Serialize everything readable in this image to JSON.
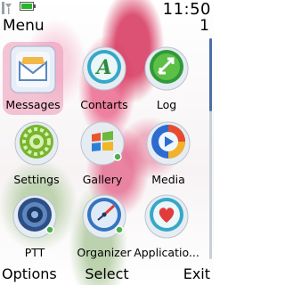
{
  "status": {
    "time": "11:50"
  },
  "header": {
    "title": "Menu",
    "page": "1"
  },
  "menu": {
    "items": [
      {
        "label": "Messages",
        "icon": "messages-icon",
        "selected": true
      },
      {
        "label": "Contarts",
        "icon": "contacts-icon"
      },
      {
        "label": "Log",
        "icon": "log-icon"
      },
      {
        "label": "Settings",
        "icon": "settings-icon"
      },
      {
        "label": "Gallery",
        "icon": "gallery-icon"
      },
      {
        "label": "Media",
        "icon": "media-icon"
      },
      {
        "label": "PTT",
        "icon": "ptt-icon"
      },
      {
        "label": "Organizer",
        "icon": "organizer-icon"
      },
      {
        "label": "Applicatio...",
        "icon": "applications-icon"
      }
    ]
  },
  "softkeys": {
    "left": "Options",
    "middle": "Select",
    "right": "Exit"
  },
  "colors": {
    "highlight": "#ec96b4",
    "scroll_thumb": "#4a6fa5"
  }
}
